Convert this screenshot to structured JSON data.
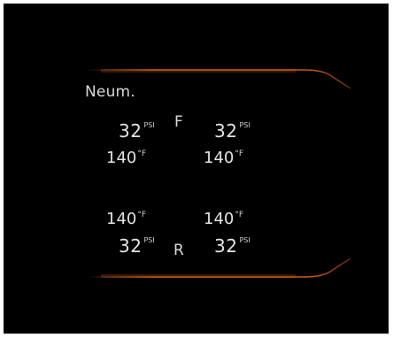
{
  "title": "Neum.",
  "front_label": "F",
  "rear_label": "R",
  "colors": {
    "background": "#000000",
    "accent": "#e0631a",
    "text": "#e3e3e3",
    "divider": "#5a5a5a"
  },
  "tires": {
    "front_left": {
      "pressure": "32",
      "pressure_unit": "PSI",
      "temp": "140",
      "temp_unit": "°F"
    },
    "front_right": {
      "pressure": "32",
      "pressure_unit": "PSI",
      "temp": "140",
      "temp_unit": "°F"
    },
    "rear_left": {
      "pressure": "32",
      "pressure_unit": "PSI",
      "temp": "140",
      "temp_unit": "°F"
    },
    "rear_right": {
      "pressure": "32",
      "pressure_unit": "PSI",
      "temp": "140",
      "temp_unit": "°F"
    }
  }
}
